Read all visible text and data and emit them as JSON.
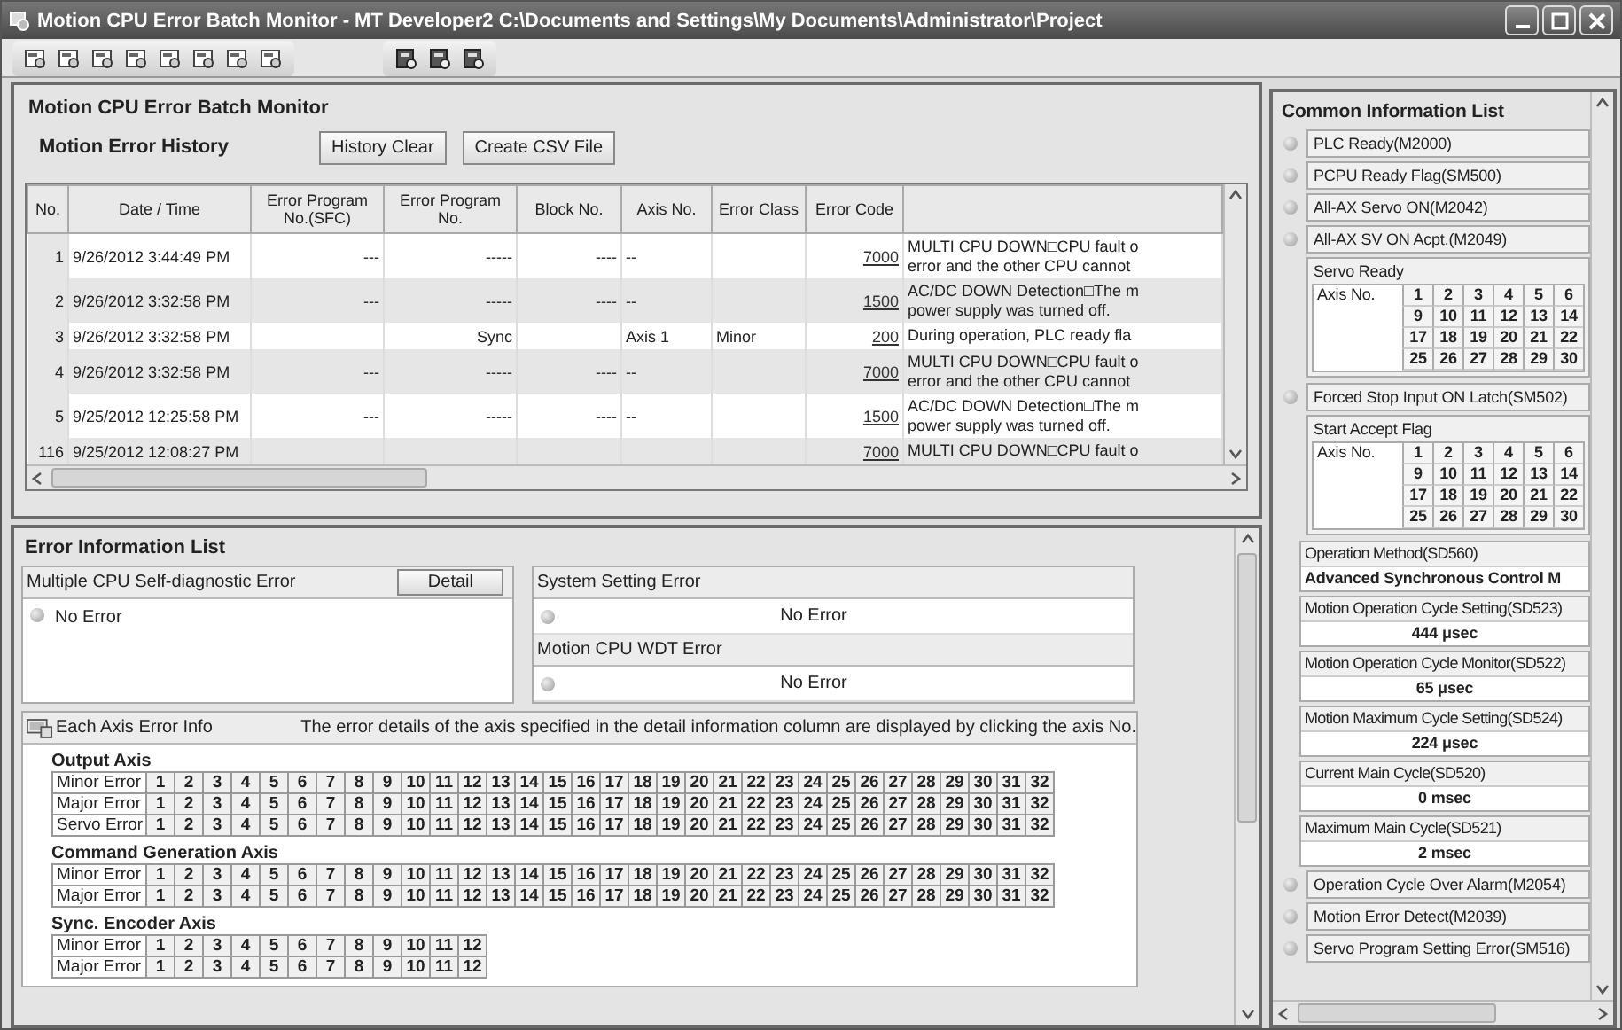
{
  "window": {
    "title": "Motion CPU Error Batch Monitor - MT Developer2 C:\\Documents and Settings\\My Documents\\Administrator\\Project"
  },
  "history": {
    "title": "Motion CPU Error Batch Monitor",
    "subtitle": "Motion Error History",
    "buttons": [
      "History Clear",
      "Create CSV File"
    ],
    "columns": [
      "No.",
      "Date / Time",
      "Error Program No.(SFC)",
      "Error Program No.",
      "Block No.",
      "Axis No.",
      "Error Class",
      "Error Code"
    ],
    "rows": [
      {
        "no": "1",
        "datetime": "9/26/2012 3:44:49 PM",
        "sfc": "---",
        "program": "-----",
        "block": "----",
        "axis": "--",
        "code": "7000",
        "message": [
          "MULTI CPU DOWN□CPU fault o",
          "error and the other CPU cannot"
        ]
      },
      {
        "no": "2",
        "datetime": "9/26/2012 3:32:58 PM",
        "sfc": "---",
        "program": "-----",
        "block": "----",
        "axis": "--",
        "code": "1500",
        "message": [
          "AC/DC DOWN Detection□The m",
          "power supply was turned off."
        ]
      },
      {
        "no": "3",
        "datetime": "9/26/2012 3:32:58 PM",
        "program": "Sync",
        "axis": "Axis  1",
        "class": "Minor",
        "code": "200",
        "message": [
          "During operation, PLC ready fla"
        ]
      },
      {
        "no": "4",
        "datetime": "9/26/2012 3:32:58 PM",
        "sfc": "---",
        "program": "-----",
        "block": "----",
        "axis": "--",
        "code": "7000",
        "message": [
          "MULTI CPU DOWN□CPU fault o",
          "error and the other CPU cannot"
        ]
      },
      {
        "no": "5",
        "datetime": "9/25/2012 12:25:58 PM",
        "sfc": "---",
        "program": "-----",
        "block": "----",
        "axis": "--",
        "code": "1500",
        "message": [
          "AC/DC DOWN Detection□The m",
          "power supply was turned off."
        ]
      },
      {
        "no": "116",
        "datetime": "9/25/2012 12:08:27 PM",
        "code": "7000",
        "message": [
          "MULTI CPU DOWN□CPU fault o"
        ]
      }
    ]
  },
  "error_info": {
    "title": "Error Information List",
    "self_diag": {
      "label": "Multiple CPU Self-diagnostic Error",
      "button": "Detail",
      "status": "No Error",
      "lit": false
    },
    "system_setting": {
      "label": "System Setting Error",
      "status": "No Error",
      "lit": false
    },
    "wdt": {
      "label": "Motion CPU WDT Error",
      "status": "No Error",
      "lit": false
    },
    "axis_info": {
      "label": "Each Axis Error Info",
      "description": "The error details of the axis specified in the detail information column are displayed by clicking the axis No.",
      "groups": [
        {
          "title": "Output Axis",
          "rows": [
            {
              "label": "Minor Error",
              "cells": [
                "1",
                "2",
                "3",
                "4",
                "5",
                "6",
                "7",
                "8",
                "9",
                "10",
                "11",
                "12",
                "13",
                "14",
                "15",
                "16",
                "17",
                "18",
                "19",
                "20",
                "21",
                "22",
                "23",
                "24",
                "25",
                "26",
                "27",
                "28",
                "29",
                "30",
                "31",
                "32"
              ]
            },
            {
              "label": "Major Error",
              "cells": [
                "1",
                "2",
                "3",
                "4",
                "5",
                "6",
                "7",
                "8",
                "9",
                "10",
                "11",
                "12",
                "13",
                "14",
                "15",
                "16",
                "17",
                "18",
                "19",
                "20",
                "21",
                "22",
                "23",
                "24",
                "25",
                "26",
                "27",
                "28",
                "29",
                "30",
                "31",
                "32"
              ]
            },
            {
              "label": "Servo Error",
              "cells": [
                "1",
                "2",
                "3",
                "4",
                "5",
                "6",
                "7",
                "8",
                "9",
                "10",
                "11",
                "12",
                "13",
                "14",
                "15",
                "16",
                "17",
                "18",
                "19",
                "20",
                "21",
                "22",
                "23",
                "24",
                "25",
                "26",
                "27",
                "28",
                "29",
                "30",
                "31",
                "32"
              ]
            }
          ]
        },
        {
          "title": "Command Generation Axis",
          "rows": [
            {
              "label": "Minor Error",
              "cells": [
                "1",
                "2",
                "3",
                "4",
                "5",
                "6",
                "7",
                "8",
                "9",
                "10",
                "11",
                "12",
                "13",
                "14",
                "15",
                "16",
                "17",
                "18",
                "19",
                "20",
                "21",
                "22",
                "23",
                "24",
                "25",
                "26",
                "27",
                "28",
                "29",
                "30",
                "31",
                "32"
              ]
            },
            {
              "label": "Major Error",
              "cells": [
                "1",
                "2",
                "3",
                "4",
                "5",
                "6",
                "7",
                "8",
                "9",
                "10",
                "11",
                "12",
                "13",
                "14",
                "15",
                "16",
                "17",
                "18",
                "19",
                "20",
                "21",
                "22",
                "23",
                "24",
                "25",
                "26",
                "27",
                "28",
                "29",
                "30",
                "31",
                "32"
              ]
            }
          ]
        },
        {
          "title": "Sync. Encoder Axis",
          "rows": [
            {
              "label": "Minor Error",
              "cells": [
                "1",
                "2",
                "3",
                "4",
                "5",
                "6",
                "7",
                "8",
                "9",
                "10",
                "11",
                "12"
              ]
            },
            {
              "label": "Major Error",
              "cells": [
                "1",
                "2",
                "3",
                "4",
                "5",
                "6",
                "7",
                "8",
                "9",
                "10",
                "11",
                "12"
              ]
            }
          ]
        }
      ]
    }
  },
  "common": {
    "title": "Common Information List",
    "items": [
      {
        "kind": "lamp",
        "label": "PLC Ready(M2000)",
        "lit": false
      },
      {
        "kind": "lamp",
        "label": "PCPU Ready Flag(SM500)",
        "lit": false
      },
      {
        "kind": "lamp",
        "label": "All-AX Servo ON(M2042)",
        "lit": false
      },
      {
        "kind": "lamp",
        "label": "All-AX SV ON Acpt.(M2049)",
        "lit": false
      },
      {
        "kind": "grid",
        "label": "Servo Ready",
        "axis_label": "Axis No.",
        "cells": [
          "1",
          "2",
          "3",
          "4",
          "5",
          "6",
          "9",
          "10",
          "11",
          "12",
          "13",
          "14",
          "17",
          "18",
          "19",
          "20",
          "21",
          "22",
          "25",
          "26",
          "27",
          "28",
          "29",
          "30"
        ]
      },
      {
        "kind": "lamp",
        "label": "Forced Stop Input ON Latch(SM502)",
        "lit": false
      },
      {
        "kind": "grid",
        "label": "Start Accept Flag",
        "axis_label": "Axis No.",
        "cells": [
          "1",
          "2",
          "3",
          "4",
          "5",
          "6",
          "9",
          "10",
          "11",
          "12",
          "13",
          "14",
          "17",
          "18",
          "19",
          "20",
          "21",
          "22",
          "25",
          "26",
          "27",
          "28",
          "29",
          "30"
        ]
      },
      {
        "kind": "text",
        "label": "Operation Method(SD560)",
        "value": "Advanced Synchronous Control M"
      },
      {
        "kind": "value",
        "label": "Motion Operation Cycle Setting(SD523)",
        "value": "444 μsec"
      },
      {
        "kind": "value",
        "label": "Motion Operation Cycle Monitor(SD522)",
        "value": "65 μsec"
      },
      {
        "kind": "value",
        "label": "Motion Maximum Cycle Setting(SD524)",
        "value": "224 μsec"
      },
      {
        "kind": "value",
        "label": "Current Main Cycle(SD520)",
        "value": "0 msec"
      },
      {
        "kind": "value",
        "label": "Maximum Main Cycle(SD521)",
        "value": "2 msec"
      },
      {
        "kind": "lamp",
        "label": "Operation Cycle Over Alarm(M2054)",
        "lit": false
      },
      {
        "kind": "lamp",
        "label": "Motion Error Detect(M2039)",
        "lit": false
      },
      {
        "kind": "lamp",
        "label": "Servo Program Setting Error(SM516)",
        "lit": false
      }
    ]
  }
}
